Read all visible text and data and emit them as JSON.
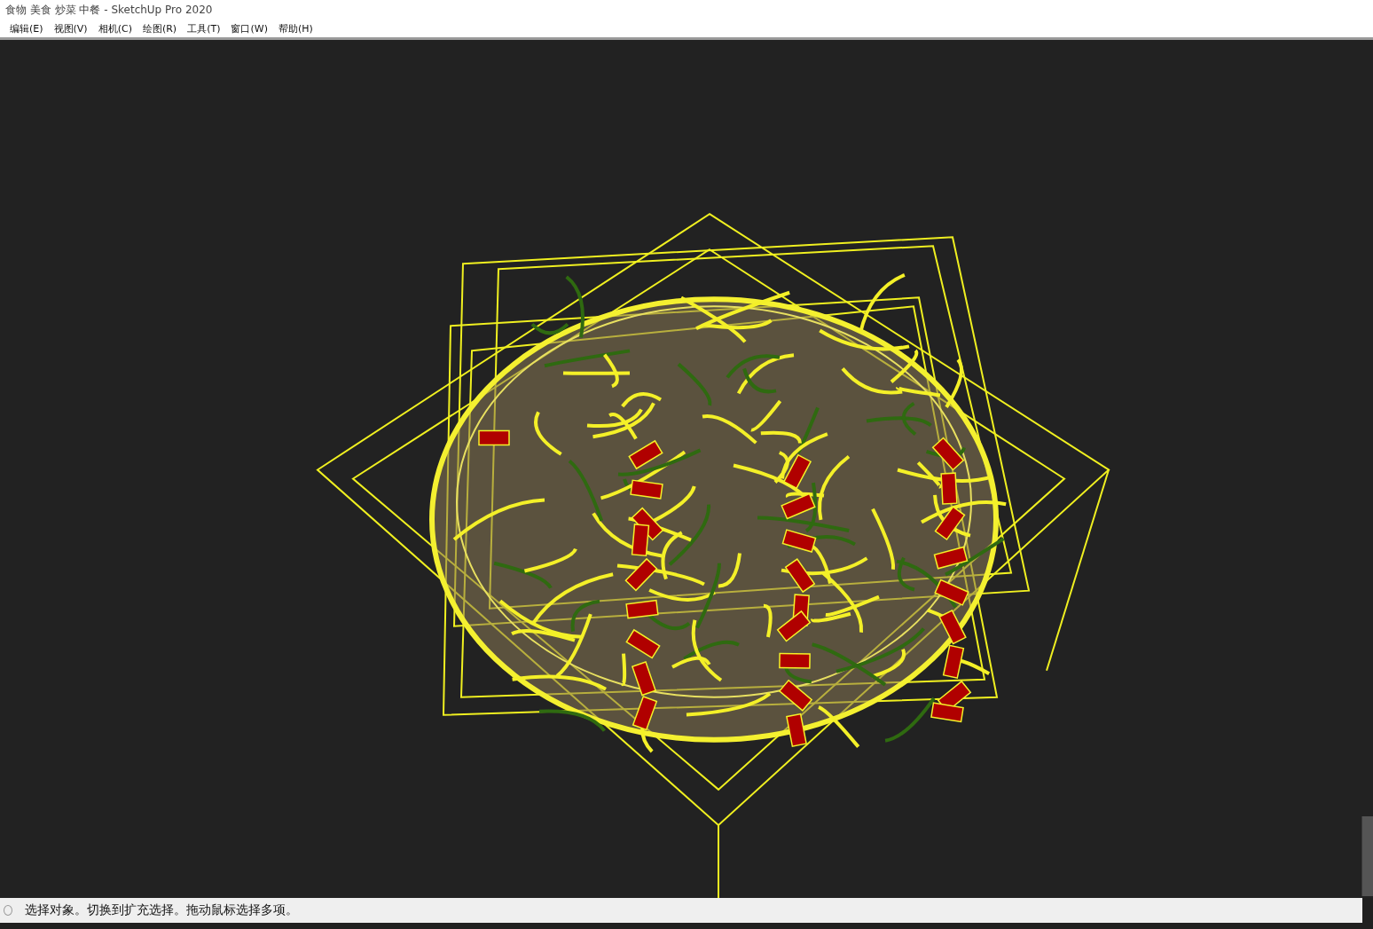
{
  "window": {
    "title": "食物 美食 炒菜 中餐 - SketchUp Pro 2020"
  },
  "menu": [
    {
      "label": "编辑(E)"
    },
    {
      "label": "视图(V)"
    },
    {
      "label": "相机(C)"
    },
    {
      "label": "绘图(R)"
    },
    {
      "label": "工具(T)"
    },
    {
      "label": "窗口(W)"
    },
    {
      "label": "帮助(H)"
    }
  ],
  "status_bar": {
    "message": "选择对象。切换到扩充选择。拖动鼠标选择多项。"
  }
}
